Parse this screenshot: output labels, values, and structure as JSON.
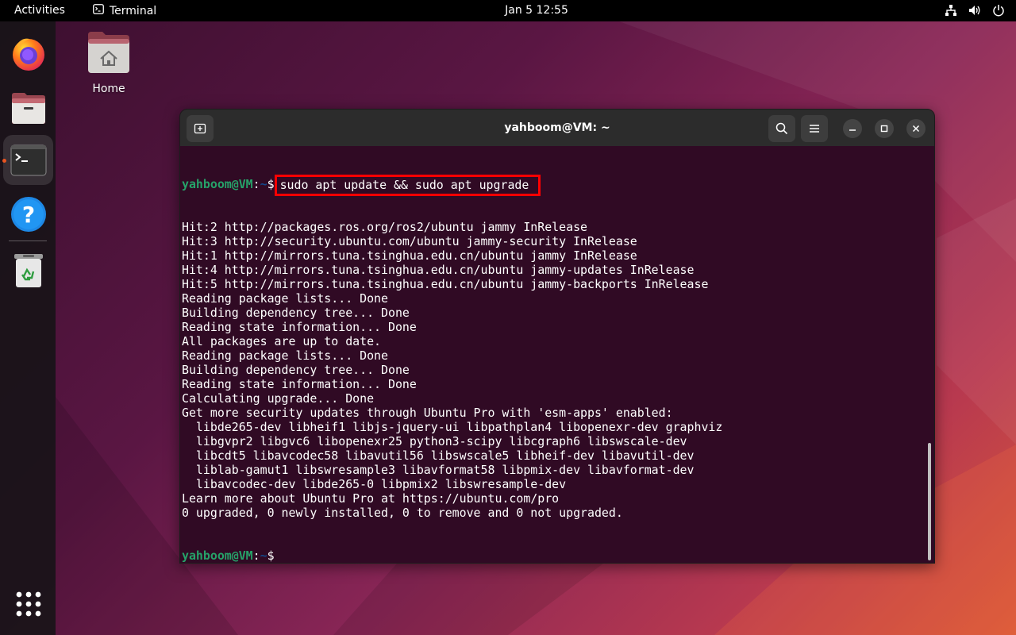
{
  "topbar": {
    "activities": "Activities",
    "app_name": "Terminal",
    "clock": "Jan 5  12:55"
  },
  "desktop": {
    "home_label": "Home"
  },
  "dock": {
    "items": [
      "firefox-icon",
      "files-icon",
      "terminal-icon",
      "help-icon",
      "trash-icon",
      "app-grid-icon"
    ]
  },
  "terminal": {
    "title": "yahboom@VM: ~",
    "prompt_user": "yahboom@VM",
    "prompt_path": "~",
    "prompt_symbol": "$",
    "command": "sudo apt update && sudo apt upgrade",
    "output": [
      "Hit:2 http://packages.ros.org/ros2/ubuntu jammy InRelease",
      "Hit:3 http://security.ubuntu.com/ubuntu jammy-security InRelease",
      "Hit:1 http://mirrors.tuna.tsinghua.edu.cn/ubuntu jammy InRelease",
      "Hit:4 http://mirrors.tuna.tsinghua.edu.cn/ubuntu jammy-updates InRelease",
      "Hit:5 http://mirrors.tuna.tsinghua.edu.cn/ubuntu jammy-backports InRelease",
      "Reading package lists... Done",
      "Building dependency tree... Done",
      "Reading state information... Done",
      "All packages are up to date.",
      "Reading package lists... Done",
      "Building dependency tree... Done",
      "Reading state information... Done",
      "Calculating upgrade... Done",
      "Get more security updates through Ubuntu Pro with 'esm-apps' enabled:",
      "  libde265-dev libheif1 libjs-jquery-ui libpathplan4 libopenexr-dev graphviz",
      "  libgvpr2 libgvc6 libopenexr25 python3-scipy libcgraph6 libswscale-dev",
      "  libcdt5 libavcodec58 libavutil56 libswscale5 libheif-dev libavutil-dev",
      "  liblab-gamut1 libswresample3 libavformat58 libpmix-dev libavformat-dev",
      "  libavcodec-dev libde265-0 libpmix2 libswresample-dev",
      "Learn more about Ubuntu Pro at https://ubuntu.com/pro",
      "0 upgraded, 0 newly installed, 0 to remove and 0 not upgraded."
    ]
  },
  "colors": {
    "terminal_bg": "#300a24",
    "prompt_user": "#26a269",
    "prompt_path": "#12488b",
    "highlight": "#ff0000",
    "accent": "#e95420"
  }
}
